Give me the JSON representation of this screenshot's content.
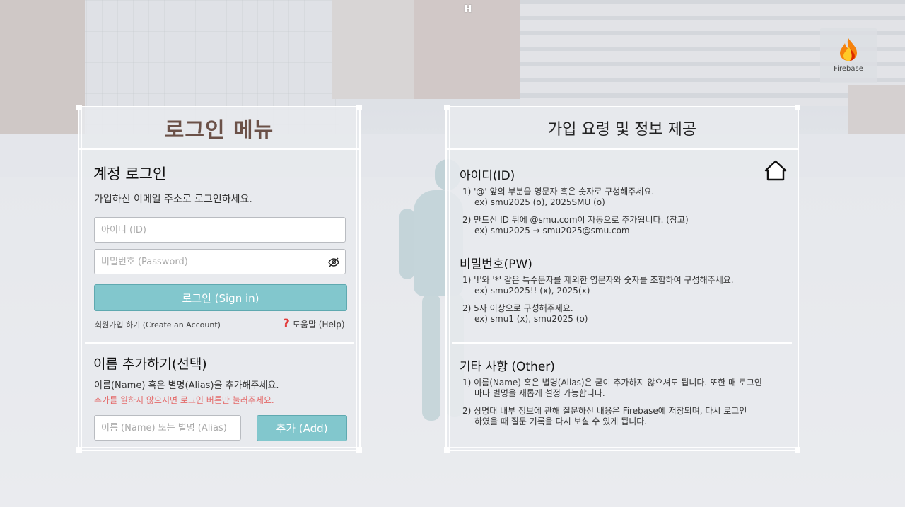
{
  "top_mark": "H",
  "firebase": {
    "label": "Firebase",
    "icon": "firebase-flame-icon"
  },
  "login": {
    "title": "로그인 메뉴",
    "account_heading": "계정 로그인",
    "account_desc": "가입하신 이메일 주소로 로그인하세요.",
    "id_placeholder": "아이디 (ID)",
    "pw_placeholder": "비밀번호 (Password)",
    "signin_label": "로그인 (Sign in)",
    "create_account": "회원가입 하기 (Create an Account)",
    "help": "도움말 (Help)",
    "alias_heading": "이름 추가하기(선택)",
    "alias_desc": "이름(Name) 혹은 별명(Alias)을 추가해주세요.",
    "alias_warning": "추가를 원하지 않으시면 로그인 버튼만 눌러주세요.",
    "alias_placeholder": "이름 (Name) 또는 별명 (Alias)",
    "add_label": "추가 (Add)"
  },
  "info": {
    "title": "가입 요령 및 정보 제공",
    "id_section": {
      "title": "아이디(ID)",
      "items": [
        {
          "line": "1) '@' 앞의 부분을 영문자 혹은 숫자로 구성해주세요.",
          "sub": "ex) smu2025 (o), 2025SMU (o)"
        },
        {
          "line": "2) 만드신 ID 뒤에 @smu.com이 자동으로 추가됩니다. (참고)",
          "sub": "ex) smu2025 → smu2025@smu.com"
        }
      ]
    },
    "pw_section": {
      "title": "비밀번호(PW)",
      "items": [
        {
          "line": "1) '!'와 '*' 같은 특수문자를 제외한 영문자와 숫자를 조합하여 구성해주세요.",
          "sub": "ex) smu2025!! (x), 2025(x)"
        },
        {
          "line": "2) 5자 이상으로 구성해주세요.",
          "sub": "ex) smu1 (x), smu2025 (o)"
        }
      ]
    },
    "other_section": {
      "title": "기타 사항 (Other)",
      "items": [
        {
          "line": "1) 이름(Name) 혹은 별명(Alias)은 굳이 추가하지 않으셔도 됩니다. 또한 매 로그인",
          "sub": "마다 별명을 새롭게 설정 가능합니다."
        },
        {
          "line": "2) 상명대 내부 정보에 관해 질문하신 내용은 Firebase에 저장되며, 다시 로그인",
          "sub": "하였을 때 질문 기록을 다시 보실 수 있게 됩니다."
        }
      ]
    }
  }
}
